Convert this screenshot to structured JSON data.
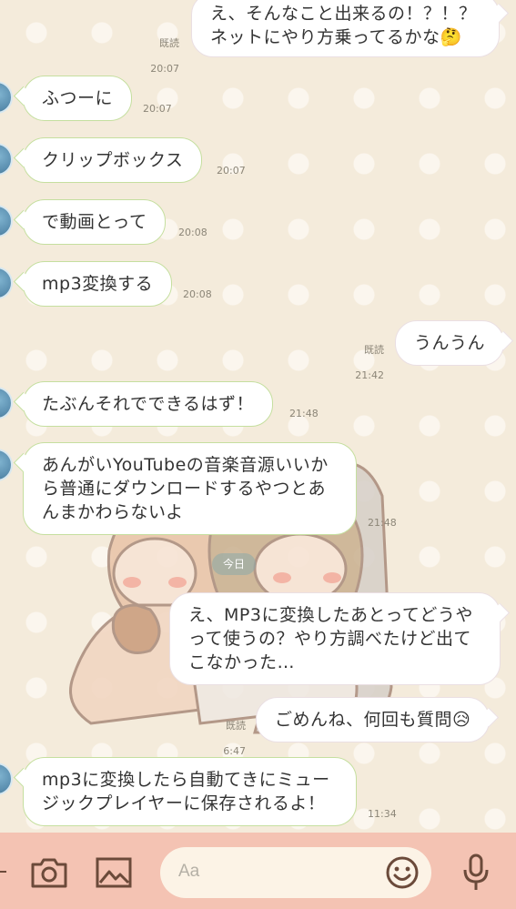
{
  "messages": [
    {
      "id": "m1",
      "side": "out",
      "text": "え、そんなこと出来るの！？！？\nネットにやり方乗ってるかな🤔",
      "read": "既読",
      "time": "20:07"
    },
    {
      "id": "m2",
      "side": "in",
      "text": "ふつーに",
      "time": "20:07"
    },
    {
      "id": "m3",
      "side": "in",
      "text": "クリップボックス",
      "time": "20:07"
    },
    {
      "id": "m4",
      "side": "in",
      "text": "で動画とって",
      "time": "20:08"
    },
    {
      "id": "m5",
      "side": "in",
      "text": "mp3変換する",
      "time": "20:08"
    },
    {
      "id": "m6",
      "side": "out",
      "text": "うんうん",
      "read": "既読",
      "time": "21:42"
    },
    {
      "id": "m7",
      "side": "in",
      "text": "たぶんそれでできるはず！",
      "time": "21:48"
    },
    {
      "id": "m8",
      "side": "in",
      "text": "あんがいYouTubeの音楽音源いいか\nら普通にダウンロードするやつとあ\nんまかわらないよ",
      "time": "21:48"
    },
    {
      "id": "m9",
      "side": "out",
      "text": "え、MP3に変換したあとってどうや\nって使うの？やり方調べたけど出て\nこなかった…",
      "read": "",
      "time": ""
    },
    {
      "id": "m10",
      "side": "out",
      "text": "ごめんね、何回も質問😥",
      "read": "既読",
      "time": "6:47"
    },
    {
      "id": "m11",
      "side": "in",
      "text": "mp3に変換したら自動てきにミュー\nジックプレイヤーに保存されるよ！",
      "time": "11:34"
    }
  ],
  "date_divider": "今日",
  "input": {
    "placeholder": "Aa"
  },
  "icons": {
    "camera": "camera-icon",
    "image": "image-icon",
    "emoji": "emoji-icon",
    "mic": "microphone-icon"
  },
  "colors": {
    "background": "#f4ebdb",
    "incoming_border": "#c5df9f",
    "input_bar": "#f4c3b3"
  }
}
